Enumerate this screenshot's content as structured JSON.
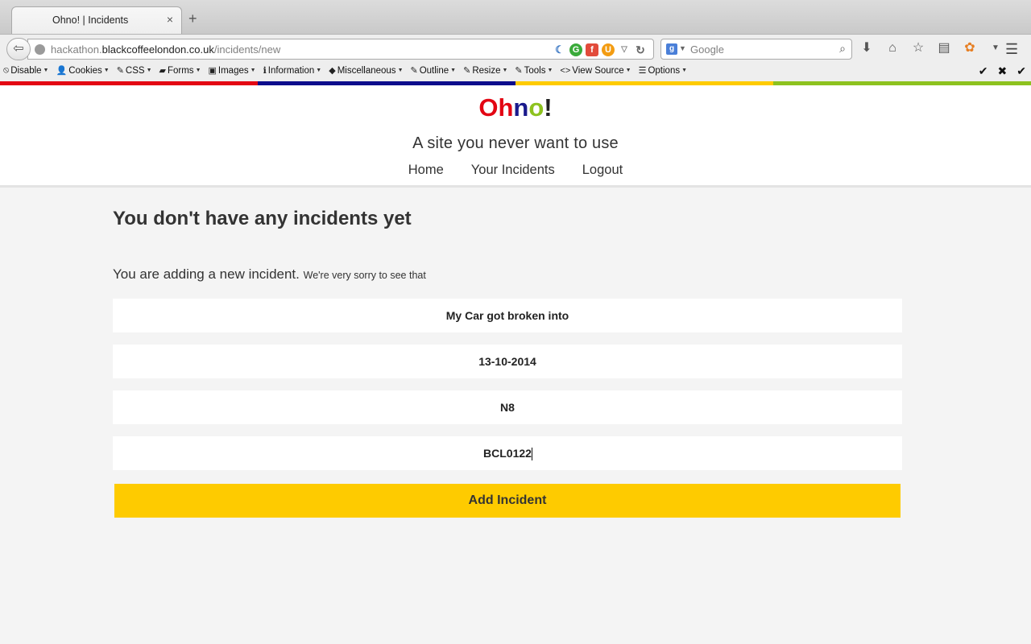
{
  "browser": {
    "tab_title": "Ohno! | Incidents",
    "tab_close": "×",
    "new_tab": "+",
    "url": {
      "prefix": "hackathon.",
      "domain": "blackcoffeelondon.co.uk",
      "path": "/incidents/new"
    },
    "search_placeholder": "Google",
    "devtools": [
      {
        "label": "Disable",
        "icon": "⦸"
      },
      {
        "label": "Cookies",
        "icon": "👤"
      },
      {
        "label": "CSS",
        "icon": "✎"
      },
      {
        "label": "Forms",
        "icon": "▰"
      },
      {
        "label": "Images",
        "icon": "▣"
      },
      {
        "label": "Information",
        "icon": "ℹ"
      },
      {
        "label": "Miscellaneous",
        "icon": "◆"
      },
      {
        "label": "Outline",
        "icon": "✎"
      },
      {
        "label": "Resize",
        "icon": "✎"
      },
      {
        "label": "Tools",
        "icon": "✎"
      },
      {
        "label": "View Source",
        "icon": "<>"
      },
      {
        "label": "Options",
        "icon": "☰"
      }
    ],
    "strip_colors": [
      "#e30613",
      "#0d0d8c",
      "#fecb00",
      "#8dc21f"
    ]
  },
  "site": {
    "logo_letters": [
      {
        "char": "O",
        "color": "#e30613"
      },
      {
        "char": "h",
        "color": "#e30613"
      },
      {
        "char": "n",
        "color": "#1a1a8c"
      },
      {
        "char": "o",
        "color": "#8dc21f"
      },
      {
        "char": "!",
        "color": "#222222"
      }
    ],
    "tagline": "A site you never want to use",
    "nav": {
      "home": "Home",
      "incidents": "Your Incidents",
      "logout": "Logout"
    }
  },
  "main": {
    "heading": "You don't have any incidents yet",
    "intro": "You are adding a new incident.",
    "intro_small": "We're very sorry to see that",
    "fields": {
      "title": "My Car got broken into",
      "date": "13-10-2014",
      "postcode": "N8",
      "reference": "BCL0122"
    },
    "submit_label": "Add Incident"
  }
}
